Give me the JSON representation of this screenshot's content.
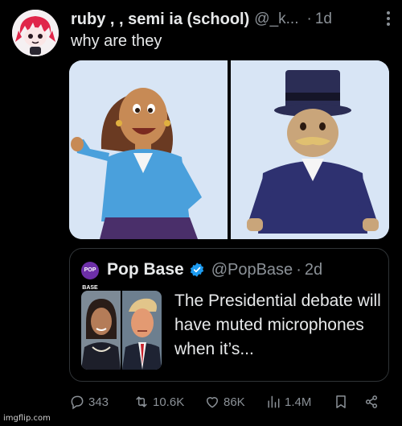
{
  "post": {
    "display_name": "ruby , , semi ia (school)",
    "handle": "@_k...",
    "separator": "·",
    "time": "1d",
    "text": "why are they"
  },
  "media": [
    {
      "icon": "cartoon-woman-image"
    },
    {
      "icon": "cartoon-man-top-hat-image"
    }
  ],
  "quote": {
    "avatar_text": "POP BASE",
    "display_name": "Pop Base",
    "handle": "@PopBase",
    "separator": "·",
    "time": "2d",
    "text": "The Presidential debate will have muted microphones when it’s..."
  },
  "actions": {
    "replies": "343",
    "reposts": "10.6K",
    "likes": "86K",
    "views": "1.4M"
  },
  "watermark": "imgflip.com",
  "colors": {
    "background": "#000000",
    "text": "#e7e9ea",
    "muted": "#8b9197",
    "border": "#2f3336",
    "verified": "#1d9bf0"
  }
}
